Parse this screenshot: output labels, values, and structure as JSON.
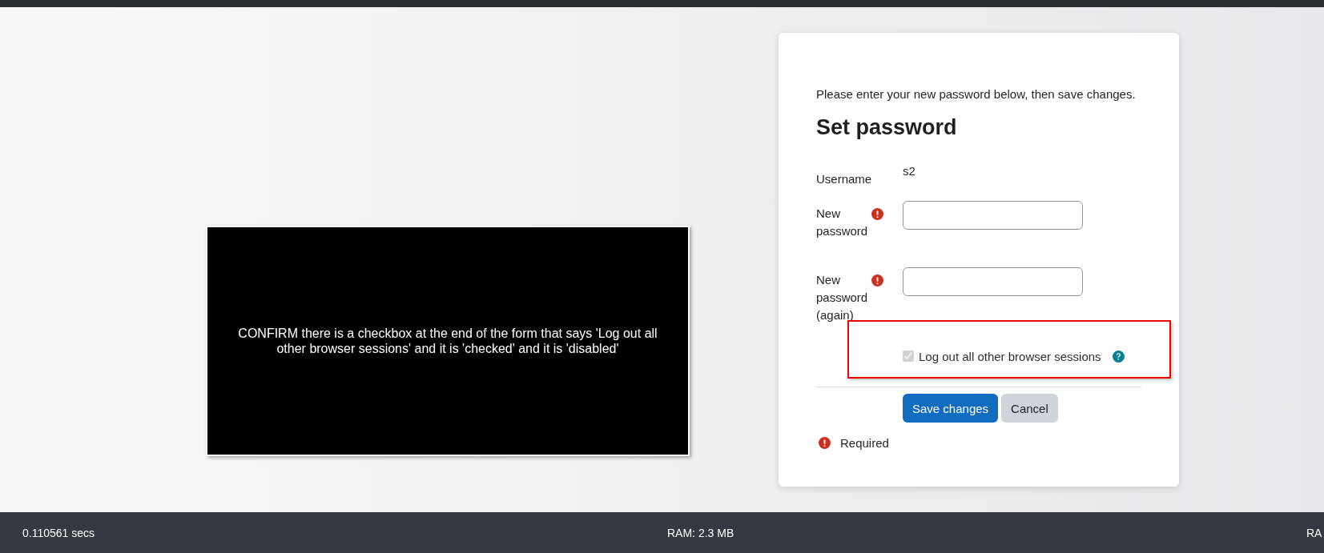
{
  "instruction_overlay": {
    "text": "CONFIRM there is a checkbox at the end of the form that says 'Log out all other browser sessions' and it is 'checked' and it is 'disabled'"
  },
  "form": {
    "intro": "Please enter your new password below, then save changes.",
    "title": "Set password",
    "fields": [
      {
        "kind": "static",
        "label": "Username",
        "value": "s2",
        "required": false
      },
      {
        "kind": "password",
        "label": "New password",
        "required": true
      },
      {
        "kind": "password",
        "label": "New password (again)",
        "required": true
      }
    ],
    "logout_checkbox": {
      "label": "Log out all other browser sessions",
      "checked": true,
      "disabled": true
    },
    "buttons": [
      {
        "label": "Save changes",
        "kind": "primary"
      },
      {
        "label": "Cancel",
        "kind": "secondary"
      }
    ],
    "required_note": "Required"
  },
  "footer": {
    "items": [
      "0.110561 secs",
      "RAM: 2.3 MB",
      "RA"
    ]
  }
}
